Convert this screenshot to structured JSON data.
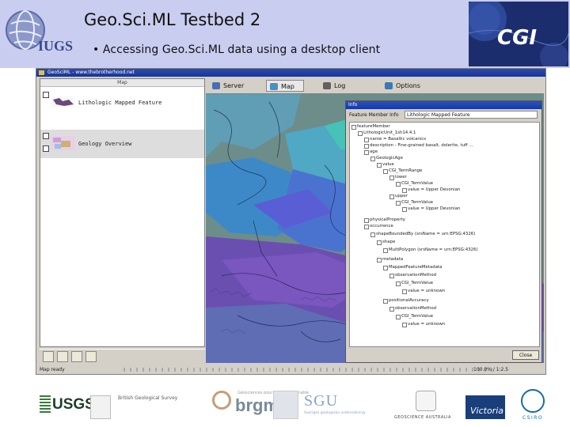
{
  "slide": {
    "title": "Geo.Sci.ML Testbed 2",
    "bullet": "• Accessing Geo.Sci.ML data using a desktop client",
    "left_logo_text": "IUGS",
    "right_logo_text": "CGI"
  },
  "window": {
    "title": "GeoSciML - www.thebrotherhood.net"
  },
  "legend": {
    "header": "Map",
    "layers": [
      {
        "label": "Lithologic Mapped Feature",
        "color": "#6a4a78"
      },
      {
        "label": "Geology Overview",
        "color": "#c8a0d8"
      }
    ]
  },
  "toolbar": {
    "tabs": [
      {
        "label": "Server",
        "icon": "server-icon",
        "color": "#4a6fb0"
      },
      {
        "label": "Map",
        "icon": "map-icon",
        "color": "#4a90c0"
      },
      {
        "label": "Log",
        "icon": "log-icon",
        "color": "#606060"
      },
      {
        "label": "Options",
        "icon": "options-icon",
        "color": "#3a7ab0"
      }
    ]
  },
  "statusbar": {
    "left": "Map ready",
    "right": "100.0% / 1:2.5"
  },
  "info": {
    "title": "Info",
    "feature_member_label": "Feature Member Info",
    "feature_member_value": "Lithologic Mapped Feature",
    "tree": [
      "featureMember",
      "LithologicUnit_1sh14.4.1",
      "name = Basaltic volcanics",
      "description - Fine-grained basalt, dolerite, tuff ...",
      "age",
      "GeologicAge",
      "value",
      "CGI_TermRange",
      "lower",
      "CGI_TermValue",
      "value = Upper Devonian",
      "upper",
      "CGI_TermValue",
      "value = Upper Devonian",
      "physicalProperty",
      "occurrence",
      "shapeBoundedBy (srsName = urn:EPSG:4326)",
      "shape",
      "MultiPolygon (srsName = urn:EPSG:4326)",
      "metadata",
      "MappedFeatureMetadata",
      "observationMethod",
      "CGI_TermValue",
      "value = unknown",
      "positionalAccuracy",
      "observationMethod",
      "CGI_TermValue",
      "value = unknown"
    ],
    "close_label": "Close"
  },
  "logos": {
    "usgs": "USGS",
    "bgs": "British Geological Survey",
    "brgm": "brgm",
    "brgm_sub": "Géosciences pour une Terre durable",
    "sgu": "SGU",
    "sgu_sub": "Sveriges geologiska undersökning",
    "ga": "GEOSCIENCE AUSTRALIA",
    "victoria": "Victoria",
    "csiro": "CSIRO"
  }
}
